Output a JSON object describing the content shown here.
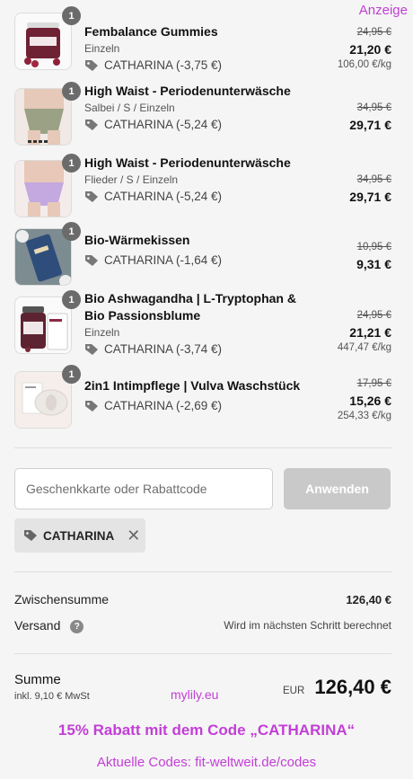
{
  "ad_label": "Anzeige",
  "items": [
    {
      "title": "Fembalance Gummies",
      "variant": "Einzeln",
      "discount": "CATHARINA (-3,75 €)",
      "qty": "1",
      "old_price": "24,95 €",
      "new_price": "21,20 €",
      "unit_price": "106,00 €/kg",
      "image": "gummies-jar"
    },
    {
      "title": "High Waist - Periodenunterwäsche",
      "variant": "Salbei / S / Einzeln",
      "discount": "CATHARINA (-5,24 €)",
      "qty": "1",
      "old_price": "34,95 €",
      "new_price": "29,71 €",
      "unit_price": "",
      "image": "underwear-sage"
    },
    {
      "title": "High Waist - Periodenunterwäsche",
      "variant": "Flieder / S / Einzeln",
      "discount": "CATHARINA (-5,24 €)",
      "qty": "1",
      "old_price": "34,95 €",
      "new_price": "29,71 €",
      "unit_price": "",
      "image": "underwear-lilac"
    },
    {
      "title": "Bio-Wärmekissen",
      "variant": "",
      "discount": "CATHARINA (-1,64 €)",
      "qty": "1",
      "old_price": "10,95 €",
      "new_price": "9,31 €",
      "unit_price": "",
      "image": "heat-pillow"
    },
    {
      "title": "Bio Ashwagandha | L-Tryptophan & Bio Passionsblume",
      "variant": "Einzeln",
      "discount": "CATHARINA (-3,74 €)",
      "qty": "1",
      "old_price": "24,95 €",
      "new_price": "21,21 €",
      "unit_price": "447,47 €/kg",
      "image": "supplement-bottle"
    },
    {
      "title": "2in1 Intimpflege | Vulva Waschstück",
      "variant": "",
      "discount": "CATHARINA (-2,69 €)",
      "qty": "1",
      "old_price": "17,95 €",
      "new_price": "15,26 €",
      "unit_price": "254,33 €/kg",
      "image": "soap-bar"
    }
  ],
  "discount_input": {
    "placeholder": "Geschenkkarte oder Rabattcode",
    "value": ""
  },
  "apply_button": "Anwenden",
  "applied_code": "CATHARINA",
  "summary": {
    "subtotal_label": "Zwischensumme",
    "subtotal_value": "126,40 €",
    "shipping_label": "Versand",
    "shipping_value": "Wird im nächsten Schritt berechnet",
    "total_label": "Summe",
    "tax_note": "inkl. 9,10 € MwSt",
    "currency": "EUR",
    "total_value": "126,40 €"
  },
  "watermark_site": "mylily.eu",
  "promo_text": "15% Rabatt mit dem Code „CATHARINA“",
  "codes_text": "Aktuelle Codes: fit-weltweit.de/codes",
  "colors": {
    "accent": "#c23fd6",
    "button_disabled": "#c9c9c9",
    "background": "#f5f5f5"
  }
}
